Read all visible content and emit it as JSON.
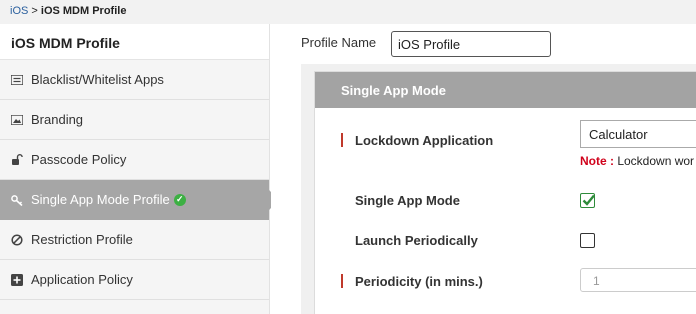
{
  "breadcrumb": {
    "parent": "iOS",
    "separator": " > ",
    "current": "iOS MDM Profile"
  },
  "sidebar": {
    "title": "iOS MDM Profile",
    "items": [
      {
        "label": "Blacklist/Whitelist Apps",
        "icon": "list-icon"
      },
      {
        "label": "Branding",
        "icon": "image-icon"
      },
      {
        "label": "Passcode Policy",
        "icon": "unlock-icon"
      },
      {
        "label": "Single App Mode Profile",
        "icon": "key-icon",
        "active": true,
        "status": "configured"
      },
      {
        "label": "Restriction Profile",
        "icon": "ban-icon"
      },
      {
        "label": "Application Policy",
        "icon": "plus-square-icon"
      }
    ]
  },
  "main": {
    "profile_name_label": "Profile Name",
    "profile_name_value": "iOS Profile",
    "panel_title": "Single App Mode",
    "fields": {
      "lockdown_label": "Lockdown Application",
      "lockdown_value": "Calculator",
      "note_prefix": "Note :",
      "note_text": " Lockdown wor",
      "single_app_label": "Single App Mode",
      "single_app_checked": true,
      "launch_label": "Launch Periodically",
      "launch_checked": false,
      "periodicity_label": "Periodicity (in mins.)",
      "periodicity_placeholder": "1"
    }
  },
  "colors": {
    "accent_header": "#a3a3a3",
    "required_marker": "#c0392b",
    "note_red": "#d0021b",
    "check_green": "#3cb043"
  }
}
